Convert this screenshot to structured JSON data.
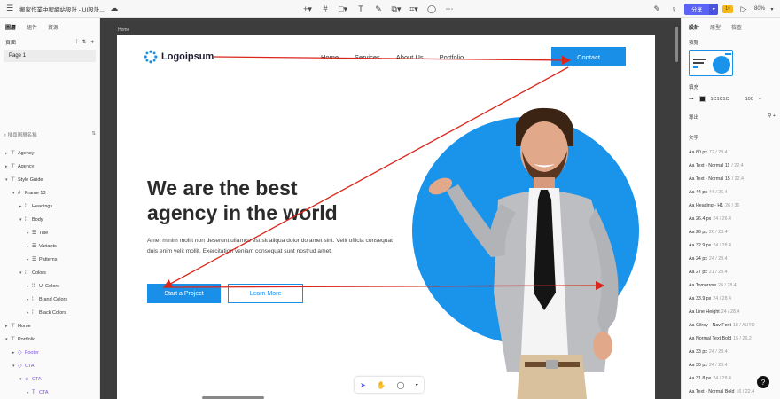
{
  "app": {
    "doc_title": "搬家作業中程網站設計 - UI設計...",
    "share_label": "分享",
    "badge_label": "1×",
    "zoom": "80%"
  },
  "left_panel": {
    "tabs": [
      "圖層",
      "組件",
      "資源"
    ],
    "pages_label": "頁面",
    "page_item": "Page 1",
    "search_placeholder": "搜尋圖層名稱",
    "layers": [
      {
        "label": "Agency",
        "indent": 0,
        "arrow": "▸",
        "icon": "⊤",
        "purple": false
      },
      {
        "label": "Agency",
        "indent": 0,
        "arrow": "▸",
        "icon": "⊤",
        "purple": false
      },
      {
        "label": "Style Guide",
        "indent": 0,
        "arrow": "▾",
        "icon": "⊤",
        "purple": false
      },
      {
        "label": "Frame 13",
        "indent": 1,
        "arrow": "▾",
        "icon": "#",
        "purple": false
      },
      {
        "label": "Headings",
        "indent": 2,
        "arrow": "▸",
        "icon": "⁞⁞",
        "purple": false
      },
      {
        "label": "Body",
        "indent": 2,
        "arrow": "▾",
        "icon": "⁞⁞",
        "purple": false
      },
      {
        "label": "Title",
        "indent": 3,
        "arrow": "▸",
        "icon": "☰",
        "purple": false
      },
      {
        "label": "Variants",
        "indent": 3,
        "arrow": "▸",
        "icon": "☰",
        "purple": false
      },
      {
        "label": "Patterns",
        "indent": 3,
        "arrow": "▸",
        "icon": "☰",
        "purple": false
      },
      {
        "label": "Colors",
        "indent": 2,
        "arrow": "▾",
        "icon": "⁞⁞",
        "purple": false
      },
      {
        "label": "UI Colors",
        "indent": 3,
        "arrow": "▸",
        "icon": "⁞⁞",
        "purple": false
      },
      {
        "label": "Brand Colors",
        "indent": 3,
        "arrow": "▸",
        "icon": "⁞",
        "purple": false
      },
      {
        "label": "Black Colors",
        "indent": 3,
        "arrow": "▸",
        "icon": "⁞",
        "purple": false
      },
      {
        "label": "Home",
        "indent": 0,
        "arrow": "▸",
        "icon": "⊤",
        "purple": false
      },
      {
        "label": "Portfolio",
        "indent": 0,
        "arrow": "▾",
        "icon": "⊤",
        "purple": false
      },
      {
        "label": "Footer",
        "indent": 1,
        "arrow": "▸",
        "icon": "◇",
        "purple": true
      },
      {
        "label": "CTA",
        "indent": 1,
        "arrow": "▾",
        "icon": "◇",
        "purple": true
      },
      {
        "label": "CTA",
        "indent": 2,
        "arrow": "▾",
        "icon": "◇",
        "purple": true
      },
      {
        "label": "CTA",
        "indent": 3,
        "arrow": "▸",
        "icon": "T",
        "purple": true
      }
    ]
  },
  "canvas": {
    "frame_label": "Home",
    "logo_text": "Logoipsum",
    "nav": [
      "Home",
      "Services",
      "About Us",
      "Portfolio"
    ],
    "contact_label": "Contact",
    "headline_1": "We are the best",
    "headline_2": "agency in the world",
    "paragraph": "Amet minim mollit non deserunt ullamco est sit aliqua dolor do amet sint. Velit officia consequat duis enim velit mollit. Exercitation veniam consequat sunt nostrud amet.",
    "btn_primary": "Start a Project",
    "btn_secondary": "Learn More",
    "colors": {
      "accent": "#1a8fe8",
      "circle": "#1a93ea",
      "arrow": "#d9261c",
      "dark_canvas": "#3d3d3d"
    }
  },
  "right_panel": {
    "tabs": [
      "設計",
      "原型",
      "檢查"
    ],
    "frame_section": "預覽",
    "fill_label": "填充",
    "fill_hex": "1C1C1C",
    "fill_opacity": "100",
    "export_label": "導出",
    "text_section": "文字",
    "text_styles": [
      {
        "name": "Aa 60 px",
        "spec": "72 / 28.4"
      },
      {
        "name": "Aa Text - Normal 11",
        "spec": "/ 22.4"
      },
      {
        "name": "Aa Text - Normal 15",
        "spec": "/ 22.4"
      },
      {
        "name": "Aa 44 px",
        "spec": "44 / 26.4"
      },
      {
        "name": "Aa Heading - H1",
        "spec": "26 / 36"
      },
      {
        "name": "Aa 26.4 px",
        "spec": "24 / 26.4"
      },
      {
        "name": "Aa 26 px",
        "spec": "26 / 28.4"
      },
      {
        "name": "Aa 32.9 px",
        "spec": "24 / 28.4"
      },
      {
        "name": "Aa 24 px",
        "spec": "24 / 28.4"
      },
      {
        "name": "Aa 27 px",
        "spec": "21 / 28.4"
      },
      {
        "name": "Aa Tomorrow",
        "spec": "24 / 28.4"
      },
      {
        "name": "Aa 33.9 px",
        "spec": "24 / 28.4"
      },
      {
        "name": "Aa Line Height",
        "spec": "24 / 28.4"
      },
      {
        "name": "Aa Gilroy - Nav Font",
        "spec": "18 / AUTO"
      },
      {
        "name": "Aa Normal Text Bold",
        "spec": "15 / 26.2"
      },
      {
        "name": "Aa 33 px",
        "spec": "24 / 28.4"
      },
      {
        "name": "Aa 30 px",
        "spec": "24 / 28.4"
      },
      {
        "name": "Aa 31.8 px",
        "spec": "24 / 28.4"
      },
      {
        "name": "Aa Text - Normal Bold",
        "spec": "16 / 22.4"
      }
    ]
  },
  "help_label": "?"
}
